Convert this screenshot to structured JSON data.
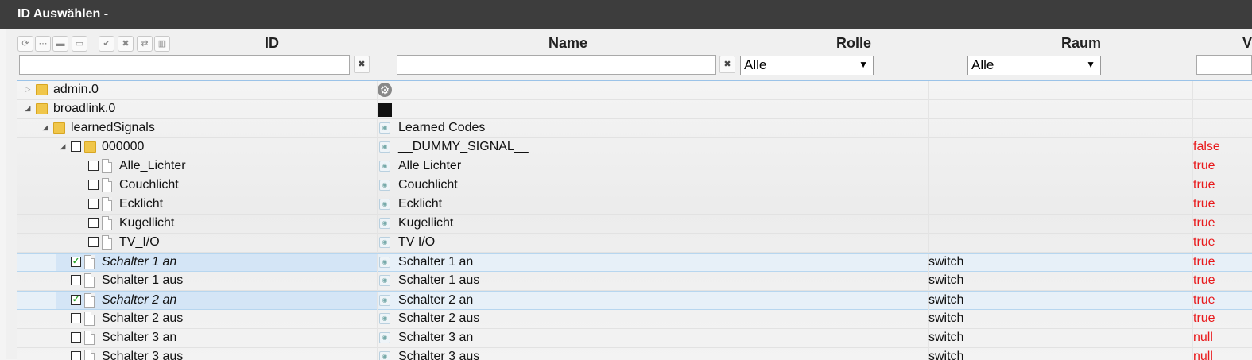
{
  "window": {
    "title": "ID Auswählen -"
  },
  "toolbar": {
    "icons": [
      "refresh-icon",
      "list-icon",
      "folder-closed-icon",
      "folder-open-icon",
      "check-circle-icon",
      "x-circle-icon",
      "swap-icon",
      "book-icon"
    ]
  },
  "columns": {
    "id": "ID",
    "name": "Name",
    "role": "Rolle",
    "room": "Raum",
    "value": "V"
  },
  "filters": {
    "id_value": "",
    "name_value": "",
    "role_selected": "Alle",
    "room_selected": "Alle",
    "value_value": ""
  },
  "colors": {
    "value_red": "#e8191b",
    "selection": "#d4e5f6",
    "titlebar": "#3d3d3d"
  },
  "rows": [
    {
      "label": "admin.0",
      "name": "",
      "role": "",
      "value": "",
      "level": 0,
      "type": "folder",
      "expander": "closed",
      "checkbox": null,
      "italic": false,
      "selected": false,
      "icon": "gear"
    },
    {
      "label": "broadlink.0",
      "name": "",
      "role": "",
      "value": "",
      "level": 0,
      "type": "folder",
      "expander": "open",
      "checkbox": null,
      "italic": false,
      "selected": false,
      "icon": "black"
    },
    {
      "label": "learnedSignals",
      "name": "Learned Codes",
      "role": "",
      "value": "",
      "level": 1,
      "type": "folder",
      "expander": "open",
      "checkbox": null,
      "italic": false,
      "selected": false,
      "icon": "state"
    },
    {
      "label": "000000",
      "name": "__DUMMY_SIGNAL__",
      "role": "",
      "value": "false",
      "level": 2,
      "type": "folder",
      "expander": "open",
      "checkbox": false,
      "italic": false,
      "selected": false,
      "icon": "state"
    },
    {
      "label": "Alle_Lichter",
      "name": "Alle Lichter",
      "role": "",
      "value": "true",
      "level": 3,
      "type": "file",
      "expander": null,
      "checkbox": false,
      "italic": false,
      "selected": false,
      "icon": "state"
    },
    {
      "label": "Couchlicht",
      "name": "Couchlicht",
      "role": "",
      "value": "true",
      "level": 3,
      "type": "file",
      "expander": null,
      "checkbox": false,
      "italic": false,
      "selected": false,
      "icon": "state"
    },
    {
      "label": "Ecklicht",
      "name": "Ecklicht",
      "role": "",
      "value": "true",
      "level": 3,
      "type": "file",
      "expander": null,
      "checkbox": false,
      "italic": false,
      "selected": false,
      "icon": "state"
    },
    {
      "label": "Kugellicht",
      "name": "Kugellicht",
      "role": "",
      "value": "true",
      "level": 3,
      "type": "file",
      "expander": null,
      "checkbox": false,
      "italic": false,
      "selected": false,
      "icon": "state"
    },
    {
      "label": "TV_I/O",
      "name": "TV I/O",
      "role": "",
      "value": "true",
      "level": 3,
      "type": "file",
      "expander": null,
      "checkbox": false,
      "italic": false,
      "selected": false,
      "icon": "state"
    },
    {
      "label": "Schalter 1 an",
      "name": "Schalter 1 an",
      "role": "switch",
      "value": "true",
      "level": 2,
      "type": "file",
      "expander": null,
      "checkbox": true,
      "italic": true,
      "selected": true,
      "icon": "state"
    },
    {
      "label": "Schalter 1 aus",
      "name": "Schalter 1 aus",
      "role": "switch",
      "value": "true",
      "level": 2,
      "type": "file",
      "expander": null,
      "checkbox": false,
      "italic": false,
      "selected": false,
      "icon": "state"
    },
    {
      "label": "Schalter 2 an",
      "name": "Schalter 2 an",
      "role": "switch",
      "value": "true",
      "level": 2,
      "type": "file",
      "expander": null,
      "checkbox": true,
      "italic": true,
      "selected": true,
      "icon": "state"
    },
    {
      "label": "Schalter 2 aus",
      "name": "Schalter 2 aus",
      "role": "switch",
      "value": "true",
      "level": 2,
      "type": "file",
      "expander": null,
      "checkbox": false,
      "italic": false,
      "selected": false,
      "icon": "state"
    },
    {
      "label": "Schalter 3 an",
      "name": "Schalter 3 an",
      "role": "switch",
      "value": "null",
      "level": 2,
      "type": "file",
      "expander": null,
      "checkbox": false,
      "italic": false,
      "selected": false,
      "icon": "state"
    },
    {
      "label": "Schalter 3 aus",
      "name": "Schalter 3 aus",
      "role": "switch",
      "value": "null",
      "level": 2,
      "type": "file",
      "expander": null,
      "checkbox": false,
      "italic": false,
      "selected": false,
      "icon": "state"
    }
  ]
}
